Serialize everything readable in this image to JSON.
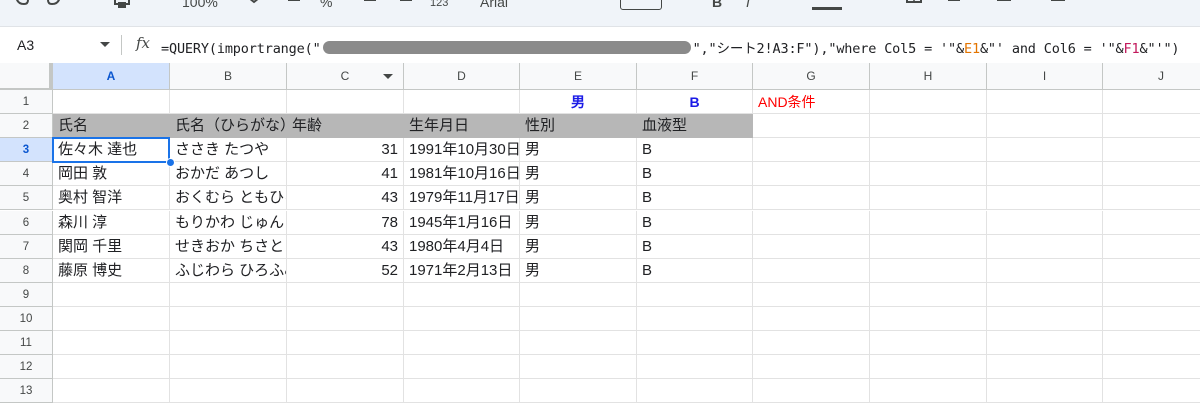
{
  "toolbar": {
    "zoom_label": "100%",
    "percent_label": "%",
    "num_format_label": "123",
    "font_label": "Arial",
    "bold_label": "B",
    "italic_label": "I"
  },
  "formula_bar": {
    "cell_ref": "A3",
    "fx_label": "fx",
    "formula_prefix": "=QUERY(importrange(\"",
    "formula_sheet_range": "\",\"シート2!A3:F\"),\"where Col5 = '\"&",
    "formula_ref_e": "E1",
    "formula_mid": "&\"' and Col6 = '\"&",
    "formula_ref_f": "F1",
    "formula_end": "&\"'\")"
  },
  "columns": [
    "A",
    "B",
    "C",
    "D",
    "E",
    "F",
    "G",
    "H",
    "I",
    "J"
  ],
  "rows": [
    "1",
    "2",
    "3",
    "4",
    "5",
    "6",
    "7",
    "8",
    "9",
    "10",
    "11",
    "12",
    "13"
  ],
  "row1": {
    "gender_criterion": "男",
    "blood_criterion": "B",
    "condition_label": "AND条件"
  },
  "table_headers": [
    "氏名",
    "氏名（ひらがな）",
    "年齢",
    "生年月日",
    "性別",
    "血液型"
  ],
  "table_rows": [
    {
      "name": "佐々木 達也",
      "kana": "ささき たつや",
      "age": "31",
      "dob": "1991年10月30日",
      "gender": "男",
      "blood": "B"
    },
    {
      "name": "岡田 敦",
      "kana": "おかだ あつし",
      "age": "41",
      "dob": "1981年10月16日",
      "gender": "男",
      "blood": "B"
    },
    {
      "name": "奥村 智洋",
      "kana": "おくむら ともひろ",
      "age": "43",
      "dob": "1979年11月17日",
      "gender": "男",
      "blood": "B"
    },
    {
      "name": "森川 淳",
      "kana": "もりかわ じゅん",
      "age": "78",
      "dob": "1945年1月16日",
      "gender": "男",
      "blood": "B"
    },
    {
      "name": "関岡 千里",
      "kana": "せきおか ちさと",
      "age": "43",
      "dob": "1980年4月4日",
      "gender": "男",
      "blood": "B"
    },
    {
      "name": "藤原 博史",
      "kana": "ふじわら ひろふみ",
      "age": "52",
      "dob": "1971年2月13日",
      "gender": "男",
      "blood": "B"
    }
  ],
  "colors": {
    "selection_blue": "#1a73e8",
    "header_fill": "#b7b7b7",
    "criterion_blue": "#1a1ae6",
    "condition_red": "#ff0000"
  }
}
